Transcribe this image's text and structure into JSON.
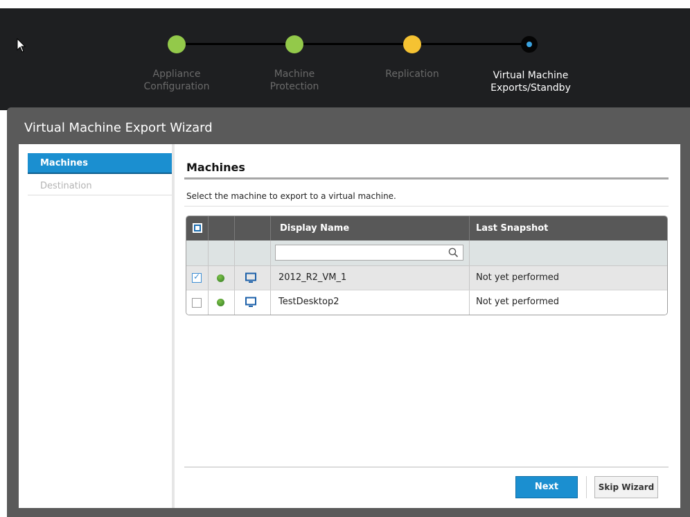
{
  "steps": [
    {
      "label": "Appliance\nConfiguration",
      "state": "done"
    },
    {
      "label": "Machine\nProtection",
      "state": "done"
    },
    {
      "label": "Replication",
      "state": "in-progress"
    },
    {
      "label": "Virtual Machine\nExports/Standby",
      "state": "current"
    }
  ],
  "wizard": {
    "title": "Virtual Machine Export Wizard",
    "nav": [
      {
        "label": "Machines",
        "active": true
      },
      {
        "label": "Destination",
        "active": false
      }
    ]
  },
  "panel": {
    "title": "Machines",
    "description": "Select the machine to export to a virtual machine."
  },
  "grid": {
    "columns": {
      "display_name": "Display Name",
      "last_snapshot": "Last Snapshot"
    },
    "filter_placeholder": "",
    "rows": [
      {
        "display_name": "2012_R2_VM_1",
        "last_snapshot": "Not yet performed",
        "checked": true,
        "status": "online",
        "icon": "monitor-icon"
      },
      {
        "display_name": "TestDesktop2",
        "last_snapshot": "Not yet performed",
        "checked": false,
        "status": "online",
        "icon": "monitor-icon"
      }
    ]
  },
  "buttons": {
    "next": "Next",
    "skip": "Skip Wizard"
  },
  "colors": {
    "accent": "#1b8fd0",
    "done": "#93c94a",
    "in_progress": "#f5c232",
    "current_dot": "#3aa2e0"
  }
}
